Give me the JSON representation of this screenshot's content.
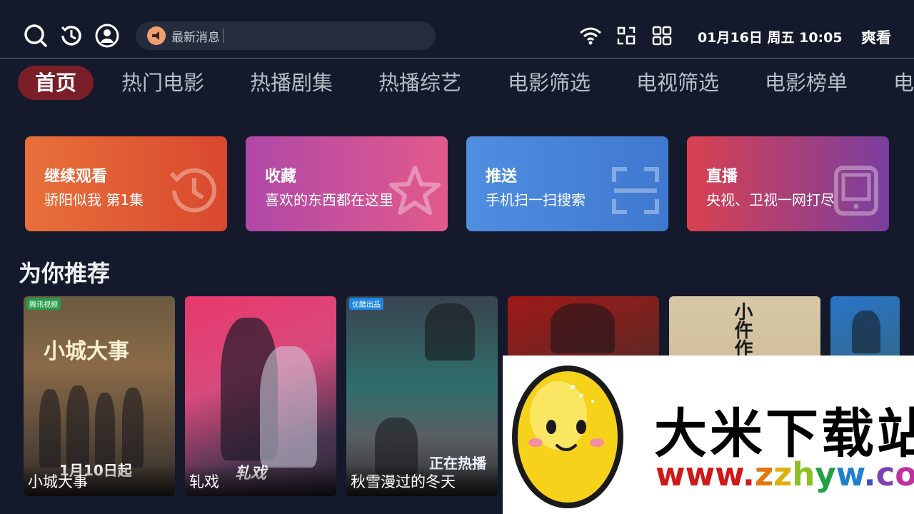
{
  "topbar": {
    "icons": [
      "search-icon",
      "history-icon",
      "user-icon"
    ],
    "news_label": "最新消息",
    "status_icons": [
      "wifi-icon",
      "scan-icon",
      "apps-grid-icon"
    ],
    "clock": "01月16日 周五 10:05",
    "brand": "爽看"
  },
  "nav": {
    "tabs": [
      "首页",
      "热门电影",
      "热播剧集",
      "热播综艺",
      "电影筛选",
      "电视筛选",
      "电影榜单",
      "电"
    ],
    "active_index": 0,
    "active_color": "#7a1f28"
  },
  "cards": [
    {
      "title": "继续观看",
      "subtitle": "骄阳似我 第1集",
      "icon": "history-icon",
      "color": "#e0603a"
    },
    {
      "title": "收藏",
      "subtitle": "喜欢的东西都在这里",
      "icon": "star-icon",
      "color": "#c9508e"
    },
    {
      "title": "推送",
      "subtitle": "手机扫一扫搜索",
      "icon": "scan-icon",
      "color": "#4a88dc"
    },
    {
      "title": "直播",
      "subtitle": "央视、卫视一网打尽",
      "icon": "tablet-icon",
      "color": "#b0405e"
    }
  ],
  "recommend": {
    "title": "为你推荐",
    "items": [
      {
        "title": "小城大事",
        "badge": "腾讯视频",
        "poster_text": "小城大事",
        "poster_date": "1月10日起"
      },
      {
        "title": "轧戏",
        "poster_text": "轧戏"
      },
      {
        "title": "秋雪漫过的冬天",
        "badge": "优酷出品",
        "poster_text": "正在热播"
      },
      {
        "title": ""
      },
      {
        "title": "",
        "poster_text": "小仵作"
      },
      {
        "title": ""
      }
    ]
  },
  "watermark": {
    "name": "大米下载站",
    "url": "www.zzhyw.com"
  }
}
